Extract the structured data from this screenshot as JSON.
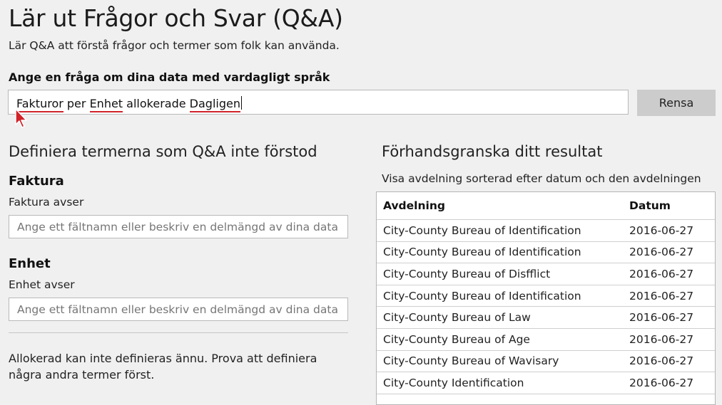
{
  "header": {
    "title": "Lär ut Frågor och Svar (Q&A)",
    "subtitle": "Lär Q&A att förstå frågor och termer som folk kan använda."
  },
  "question": {
    "label": "Ange en fråga om dina data med vardagligt språk",
    "parts": [
      "Fakturor",
      " per ",
      "Enhet",
      " allokerade ",
      "Dagligen"
    ],
    "clear_label": "Rensa"
  },
  "define": {
    "heading": "Definiera termerna som Q&A inte förstod",
    "terms": [
      {
        "name": "Faktura",
        "sub": "Faktura avser",
        "placeholder": "Ange ett fältnamn eller beskriv en delmängd av dina data"
      },
      {
        "name": "Enhet",
        "sub": "Enhet avser",
        "placeholder": "Ange ett fältnamn eller beskriv en delmängd av dina data"
      }
    ],
    "note": "Allokerad kan inte definieras ännu. Prova att definiera några andra termer först."
  },
  "preview": {
    "heading": "Förhandsgranska ditt resultat",
    "description": "Visa avdelning sorterad efter datum och den avdelningen",
    "columns": [
      "Avdelning",
      "Datum"
    ],
    "rows": [
      [
        "City-County Bureau of Identification",
        "2016-06-27"
      ],
      [
        "City-County Bureau of Identification",
        "2016-06-27"
      ],
      [
        "City-County Bureau of Disfflict",
        "2016-06-27"
      ],
      [
        "City-County Bureau of Identification",
        "2016-06-27"
      ],
      [
        "City-County Bureau of Law",
        "2016-06-27"
      ],
      [
        "City-County Bureau of Age",
        "2016-06-27"
      ],
      [
        "City-County Bureau of Wavisary",
        "2016-06-27"
      ],
      [
        "City-County  Identification",
        "2016-06-27"
      ]
    ]
  },
  "colors": {
    "background": "#f0f0f0",
    "underline": "#d0232a",
    "cursor": "#d0232a",
    "button": "#cccccc"
  },
  "icons": {
    "cursor": "mouse-pointer-icon"
  }
}
